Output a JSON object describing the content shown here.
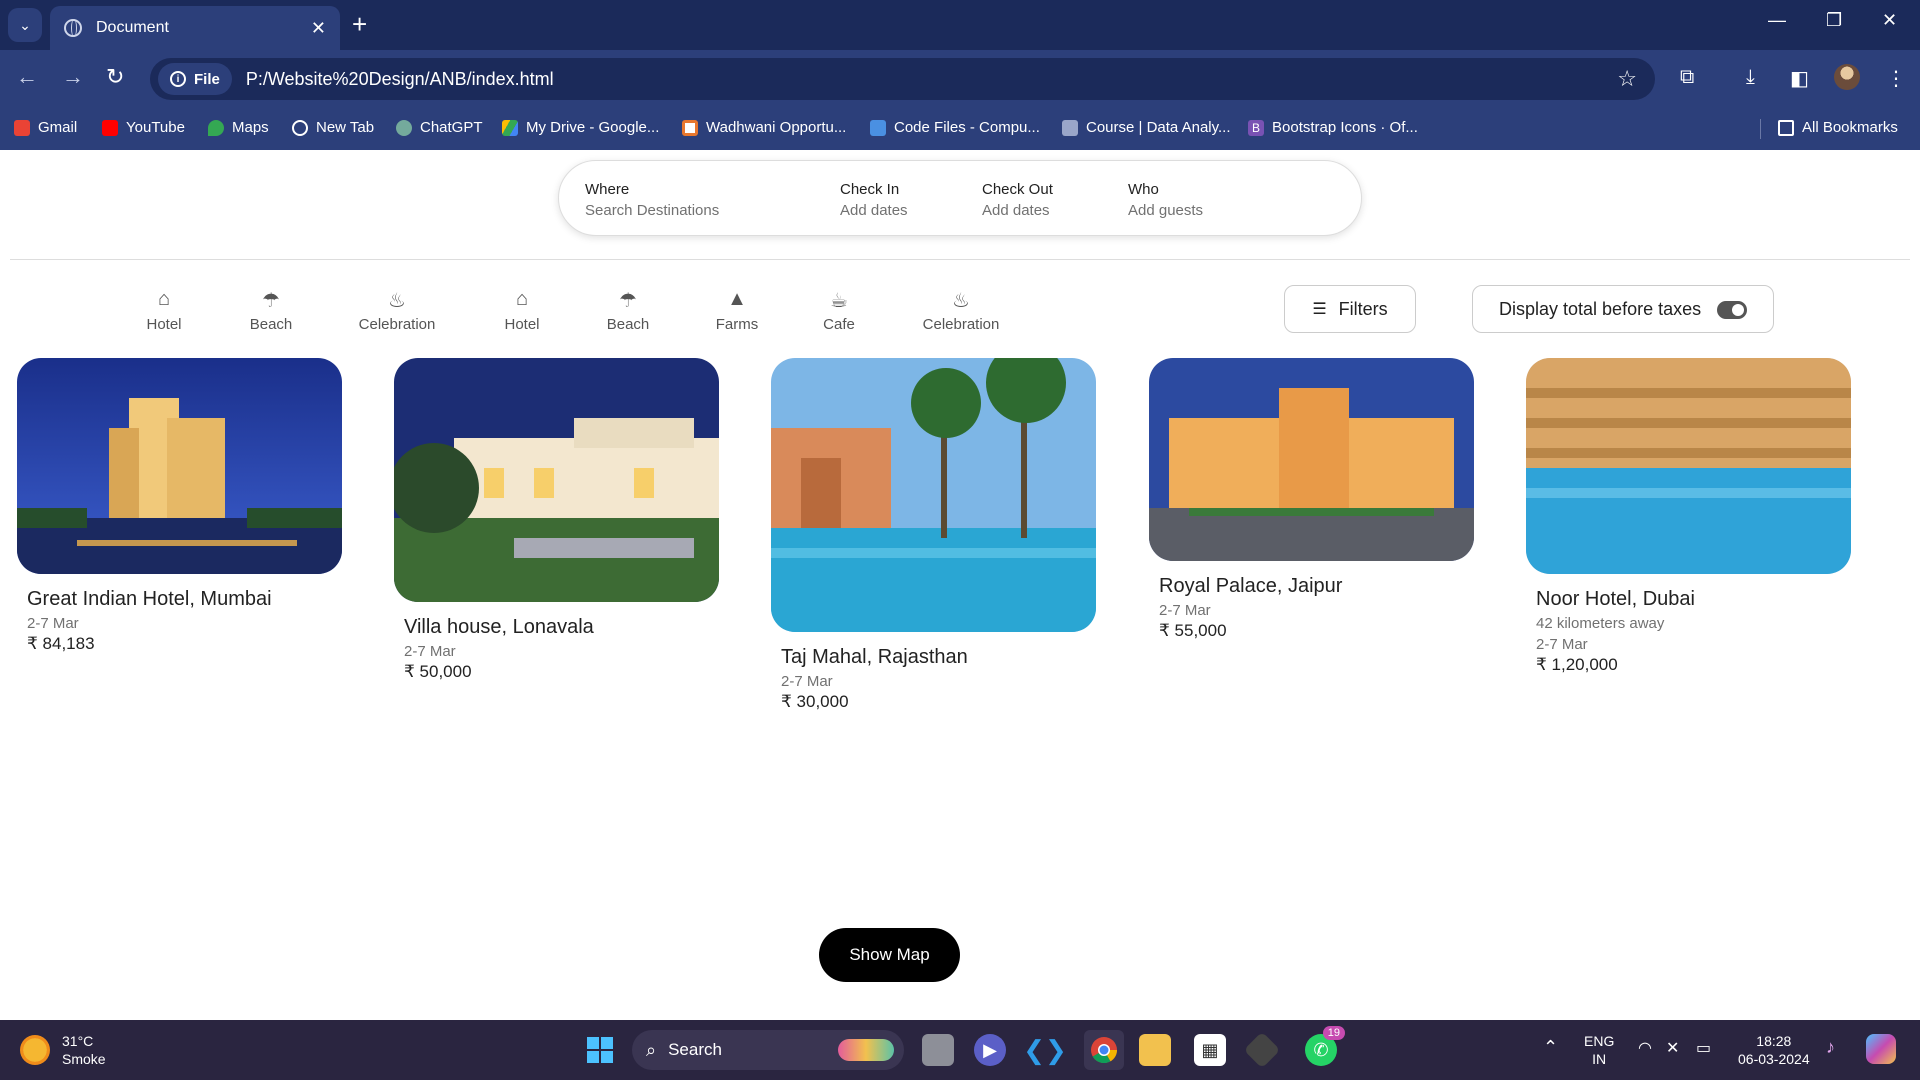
{
  "browser": {
    "tab_title": "Document",
    "url_chip": "File",
    "url": "P:/Website%20Design/ANB/index.html",
    "bookmarks": [
      {
        "label": "Gmail",
        "icon": "gmail-icon",
        "color": "#ea4335"
      },
      {
        "label": "YouTube",
        "icon": "youtube-icon",
        "color": "#ff0000"
      },
      {
        "label": "Maps",
        "icon": "maps-icon",
        "color": "#34a853"
      },
      {
        "label": "New Tab",
        "icon": "globe-icon",
        "color": "#ffffff"
      },
      {
        "label": "ChatGPT",
        "icon": "chatgpt-icon",
        "color": "#74aa9c"
      },
      {
        "label": "My Drive - Google...",
        "icon": "drive-icon",
        "color": "#fbbc04"
      },
      {
        "label": "Wadhwani Opportu...",
        "icon": "wadhwani-icon",
        "color": "#e8772e"
      },
      {
        "label": "Code Files - Compu...",
        "icon": "code-icon",
        "color": "#4a90e2"
      },
      {
        "label": "Course | Data Analy...",
        "icon": "course-icon",
        "color": "#9aa6c9"
      },
      {
        "label": "Bootstrap Icons · Of...",
        "icon": "bootstrap-icon",
        "color": "#7952b3"
      }
    ],
    "all_bookmarks": "All Bookmarks"
  },
  "search": {
    "where_label": "Where",
    "where_ph": "Search Destinations",
    "checkin_label": "Check In",
    "checkin_ph": "Add dates",
    "checkout_label": "Check Out",
    "checkout_ph": "Add dates",
    "who_label": "Who",
    "who_ph": "Add guests"
  },
  "categories": [
    {
      "label": "Hotel",
      "icon": "house-icon"
    },
    {
      "label": "Beach",
      "icon": "umbrella-icon"
    },
    {
      "label": "Celebration",
      "icon": "cake-icon"
    },
    {
      "label": "Hotel",
      "icon": "house-icon"
    },
    {
      "label": "Beach",
      "icon": "umbrella-icon"
    },
    {
      "label": "Farms",
      "icon": "tree-icon"
    },
    {
      "label": "Cafe",
      "icon": "cup-icon"
    },
    {
      "label": "Celebration",
      "icon": "cake-icon"
    }
  ],
  "filters_label": "Filters",
  "taxes_label": "Display total before taxes",
  "listings": [
    {
      "name": "Great Indian Hotel, Mumbai",
      "dates": "2-7 Mar",
      "price": "₹ 84,183"
    },
    {
      "name": "Villa house, Lonavala",
      "dates": "2-7 Mar",
      "price": "₹ 50,000"
    },
    {
      "name": "Taj Mahal, Rajasthan",
      "dates": "2-7 Mar",
      "price": "₹ 30,000"
    },
    {
      "name": "Royal Palace, Jaipur",
      "dates": "2-7 Mar",
      "price": "₹ 55,000"
    },
    {
      "name": "Noor Hotel, Dubai",
      "distance": "42 kilometers away",
      "dates": "2-7 Mar",
      "price": "₹ 1,20,000"
    }
  ],
  "show_map": "Show Map",
  "taskbar": {
    "temp": "31°C",
    "condition": "Smoke",
    "search": "Search",
    "lang1": "ENG",
    "lang2": "IN",
    "time": "18:28",
    "date": "06-03-2024",
    "whatsapp_badge": "19"
  }
}
